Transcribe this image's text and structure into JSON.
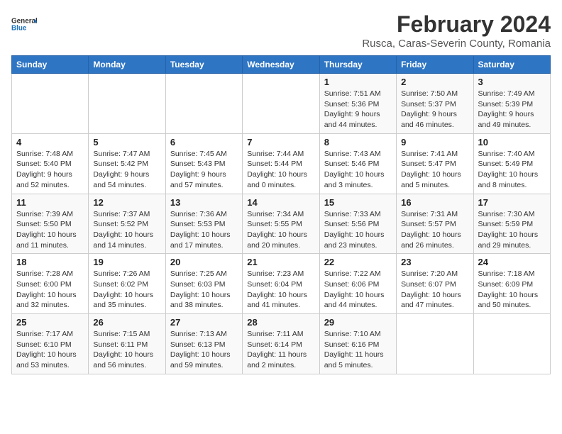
{
  "logo": {
    "line1": "General",
    "line2": "Blue"
  },
  "title": "February 2024",
  "location": "Rusca, Caras-Severin County, Romania",
  "days_of_week": [
    "Sunday",
    "Monday",
    "Tuesday",
    "Wednesday",
    "Thursday",
    "Friday",
    "Saturday"
  ],
  "weeks": [
    [
      {
        "day": "",
        "info": ""
      },
      {
        "day": "",
        "info": ""
      },
      {
        "day": "",
        "info": ""
      },
      {
        "day": "",
        "info": ""
      },
      {
        "day": "1",
        "sunrise": "Sunrise: 7:51 AM",
        "sunset": "Sunset: 5:36 PM",
        "daylight": "Daylight: 9 hours and 44 minutes."
      },
      {
        "day": "2",
        "sunrise": "Sunrise: 7:50 AM",
        "sunset": "Sunset: 5:37 PM",
        "daylight": "Daylight: 9 hours and 46 minutes."
      },
      {
        "day": "3",
        "sunrise": "Sunrise: 7:49 AM",
        "sunset": "Sunset: 5:39 PM",
        "daylight": "Daylight: 9 hours and 49 minutes."
      }
    ],
    [
      {
        "day": "4",
        "sunrise": "Sunrise: 7:48 AM",
        "sunset": "Sunset: 5:40 PM",
        "daylight": "Daylight: 9 hours and 52 minutes."
      },
      {
        "day": "5",
        "sunrise": "Sunrise: 7:47 AM",
        "sunset": "Sunset: 5:42 PM",
        "daylight": "Daylight: 9 hours and 54 minutes."
      },
      {
        "day": "6",
        "sunrise": "Sunrise: 7:45 AM",
        "sunset": "Sunset: 5:43 PM",
        "daylight": "Daylight: 9 hours and 57 minutes."
      },
      {
        "day": "7",
        "sunrise": "Sunrise: 7:44 AM",
        "sunset": "Sunset: 5:44 PM",
        "daylight": "Daylight: 10 hours and 0 minutes."
      },
      {
        "day": "8",
        "sunrise": "Sunrise: 7:43 AM",
        "sunset": "Sunset: 5:46 PM",
        "daylight": "Daylight: 10 hours and 3 minutes."
      },
      {
        "day": "9",
        "sunrise": "Sunrise: 7:41 AM",
        "sunset": "Sunset: 5:47 PM",
        "daylight": "Daylight: 10 hours and 5 minutes."
      },
      {
        "day": "10",
        "sunrise": "Sunrise: 7:40 AM",
        "sunset": "Sunset: 5:49 PM",
        "daylight": "Daylight: 10 hours and 8 minutes."
      }
    ],
    [
      {
        "day": "11",
        "sunrise": "Sunrise: 7:39 AM",
        "sunset": "Sunset: 5:50 PM",
        "daylight": "Daylight: 10 hours and 11 minutes."
      },
      {
        "day": "12",
        "sunrise": "Sunrise: 7:37 AM",
        "sunset": "Sunset: 5:52 PM",
        "daylight": "Daylight: 10 hours and 14 minutes."
      },
      {
        "day": "13",
        "sunrise": "Sunrise: 7:36 AM",
        "sunset": "Sunset: 5:53 PM",
        "daylight": "Daylight: 10 hours and 17 minutes."
      },
      {
        "day": "14",
        "sunrise": "Sunrise: 7:34 AM",
        "sunset": "Sunset: 5:55 PM",
        "daylight": "Daylight: 10 hours and 20 minutes."
      },
      {
        "day": "15",
        "sunrise": "Sunrise: 7:33 AM",
        "sunset": "Sunset: 5:56 PM",
        "daylight": "Daylight: 10 hours and 23 minutes."
      },
      {
        "day": "16",
        "sunrise": "Sunrise: 7:31 AM",
        "sunset": "Sunset: 5:57 PM",
        "daylight": "Daylight: 10 hours and 26 minutes."
      },
      {
        "day": "17",
        "sunrise": "Sunrise: 7:30 AM",
        "sunset": "Sunset: 5:59 PM",
        "daylight": "Daylight: 10 hours and 29 minutes."
      }
    ],
    [
      {
        "day": "18",
        "sunrise": "Sunrise: 7:28 AM",
        "sunset": "Sunset: 6:00 PM",
        "daylight": "Daylight: 10 hours and 32 minutes."
      },
      {
        "day": "19",
        "sunrise": "Sunrise: 7:26 AM",
        "sunset": "Sunset: 6:02 PM",
        "daylight": "Daylight: 10 hours and 35 minutes."
      },
      {
        "day": "20",
        "sunrise": "Sunrise: 7:25 AM",
        "sunset": "Sunset: 6:03 PM",
        "daylight": "Daylight: 10 hours and 38 minutes."
      },
      {
        "day": "21",
        "sunrise": "Sunrise: 7:23 AM",
        "sunset": "Sunset: 6:04 PM",
        "daylight": "Daylight: 10 hours and 41 minutes."
      },
      {
        "day": "22",
        "sunrise": "Sunrise: 7:22 AM",
        "sunset": "Sunset: 6:06 PM",
        "daylight": "Daylight: 10 hours and 44 minutes."
      },
      {
        "day": "23",
        "sunrise": "Sunrise: 7:20 AM",
        "sunset": "Sunset: 6:07 PM",
        "daylight": "Daylight: 10 hours and 47 minutes."
      },
      {
        "day": "24",
        "sunrise": "Sunrise: 7:18 AM",
        "sunset": "Sunset: 6:09 PM",
        "daylight": "Daylight: 10 hours and 50 minutes."
      }
    ],
    [
      {
        "day": "25",
        "sunrise": "Sunrise: 7:17 AM",
        "sunset": "Sunset: 6:10 PM",
        "daylight": "Daylight: 10 hours and 53 minutes."
      },
      {
        "day": "26",
        "sunrise": "Sunrise: 7:15 AM",
        "sunset": "Sunset: 6:11 PM",
        "daylight": "Daylight: 10 hours and 56 minutes."
      },
      {
        "day": "27",
        "sunrise": "Sunrise: 7:13 AM",
        "sunset": "Sunset: 6:13 PM",
        "daylight": "Daylight: 10 hours and 59 minutes."
      },
      {
        "day": "28",
        "sunrise": "Sunrise: 7:11 AM",
        "sunset": "Sunset: 6:14 PM",
        "daylight": "Daylight: 11 hours and 2 minutes."
      },
      {
        "day": "29",
        "sunrise": "Sunrise: 7:10 AM",
        "sunset": "Sunset: 6:16 PM",
        "daylight": "Daylight: 11 hours and 5 minutes."
      },
      {
        "day": "",
        "info": ""
      },
      {
        "day": "",
        "info": ""
      }
    ]
  ]
}
